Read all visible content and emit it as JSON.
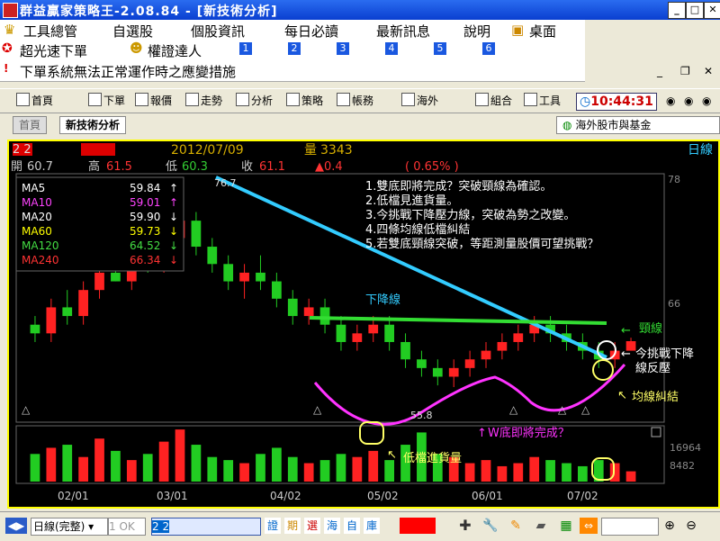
{
  "window": {
    "title": "群益贏家策略王-2.08.84 - [新技術分析]",
    "min": "_",
    "max": "□",
    "close": "✕"
  },
  "menu": {
    "items": [
      "工具總管",
      "自選股",
      "個股資訊",
      "每日必讀",
      "最新訊息",
      "說明",
      "桌面"
    ]
  },
  "menu2": {
    "item1": "超光速下單",
    "item2": "權證達人",
    "numbers": [
      "1",
      "2",
      "3",
      "4",
      "5",
      "6"
    ]
  },
  "menu3": {
    "notice": "下單系統無法正常運作時之應變措施"
  },
  "toolbar": {
    "items": [
      "首頁",
      "下單",
      "報價",
      "走勢",
      "分析",
      "策略",
      "帳務",
      "海外",
      "組合",
      "工具"
    ],
    "clock": "10:44:31"
  },
  "tabs": {
    "tab1": "首頁",
    "tab2": "新技術分析",
    "right": "海外股市與基金"
  },
  "header": {
    "code": "2  2",
    "date": "2012/07/09",
    "vol_label": "量",
    "vol": "3343",
    "period": "日線",
    "open_label": "開",
    "open": "60.7",
    "high_label": "高",
    "high": "61.5",
    "low_label": "低",
    "low": "60.3",
    "close_label": "收",
    "close": "61.1",
    "change": "▲0.4",
    "pct": "( 0.65% )"
  },
  "ma_legend": [
    {
      "name": "MA5",
      "value": "59.84",
      "arrow": "↑",
      "color": "#ffffff"
    },
    {
      "name": "MA10",
      "value": "59.01",
      "arrow": "↑",
      "color": "#ff44ff"
    },
    {
      "name": "MA20",
      "value": "59.90",
      "arrow": "↓",
      "color": "#ffffff"
    },
    {
      "name": "MA60",
      "value": "59.73",
      "arrow": "↓",
      "color": "#ffff00"
    },
    {
      "name": "MA120",
      "value": "64.52",
      "arrow": "↓",
      "color": "#44dd44"
    },
    {
      "name": "MA240",
      "value": "66.34",
      "arrow": "↓",
      "color": "#ff3333"
    }
  ],
  "annotations": {
    "notes": [
      "1.雙底即將完成？突破頸線為確認。",
      "2.低檔見進貨量。",
      "3.今挑戰下降壓力線，突破為勢之改變。",
      "4.四條均線低檔糾結",
      "5.若雙底頸線突破，等距測量股價可望挑戰？"
    ],
    "downtrend": "下降線",
    "neckline": "頸線",
    "challenge1": "今挑戰下降",
    "challenge2": "線反壓",
    "ma_tangle": "均線糾結",
    "wbottom": "W底即將完成？",
    "lowvol": "低檔進貨量",
    "high_price": "76.7",
    "low_price": "55.8"
  },
  "chart_data": {
    "type": "candlestick",
    "y_ticks": [
      "78",
      "66"
    ],
    "vol_ticks": [
      "16964",
      "8482"
    ],
    "x_labels": [
      "02/01",
      "03/01",
      "04/02",
      "05/02",
      "06/01",
      "07/02"
    ],
    "ohlc_approx": [
      [
        63,
        64,
        61,
        62
      ],
      [
        62,
        66,
        61,
        65
      ],
      [
        65,
        67,
        63,
        64
      ],
      [
        64,
        68,
        63,
        67
      ],
      [
        67,
        70,
        66,
        69
      ],
      [
        69,
        71,
        68,
        68
      ],
      [
        68,
        72,
        67,
        71
      ],
      [
        71,
        73,
        69,
        70
      ],
      [
        70,
        74,
        69,
        73
      ],
      [
        73,
        76.7,
        72,
        75
      ],
      [
        75,
        76,
        71,
        72
      ],
      [
        72,
        73,
        69,
        70
      ],
      [
        70,
        71,
        67,
        68
      ],
      [
        68,
        70,
        66,
        69
      ],
      [
        69,
        71,
        67,
        68
      ],
      [
        68,
        69,
        65,
        66
      ],
      [
        66,
        67,
        63,
        64
      ],
      [
        64,
        66,
        63,
        65
      ],
      [
        65,
        66,
        62,
        63
      ],
      [
        63,
        64,
        60,
        61
      ],
      [
        61,
        63,
        60,
        62
      ],
      [
        62,
        64,
        61,
        63
      ],
      [
        63,
        64,
        60,
        61
      ],
      [
        61,
        62,
        58,
        59
      ],
      [
        59,
        60,
        57,
        58
      ],
      [
        58,
        59,
        56,
        57
      ],
      [
        57,
        59,
        55.8,
        58
      ],
      [
        58,
        60,
        57,
        59
      ],
      [
        59,
        61,
        58,
        60
      ],
      [
        60,
        62,
        59,
        61
      ],
      [
        61,
        63,
        60,
        62
      ],
      [
        62,
        64,
        61,
        63
      ],
      [
        63,
        64,
        61,
        62
      ],
      [
        62,
        63,
        60,
        61
      ],
      [
        61,
        62,
        59,
        60
      ],
      [
        60,
        61,
        58,
        59
      ],
      [
        59,
        61,
        58,
        60
      ],
      [
        60,
        61.5,
        60.3,
        61.1
      ]
    ],
    "volumes": [
      9000,
      11000,
      12000,
      8000,
      14000,
      10000,
      7000,
      9000,
      13000,
      16964,
      12000,
      8000,
      7000,
      6000,
      9000,
      11000,
      8000,
      6000,
      7000,
      9000,
      8000,
      10000,
      7000,
      12000,
      16000,
      9000,
      8000,
      6000,
      7000,
      5000,
      6000,
      8000,
      7000,
      6000,
      5000,
      7000,
      6000,
      3343
    ]
  }
}
